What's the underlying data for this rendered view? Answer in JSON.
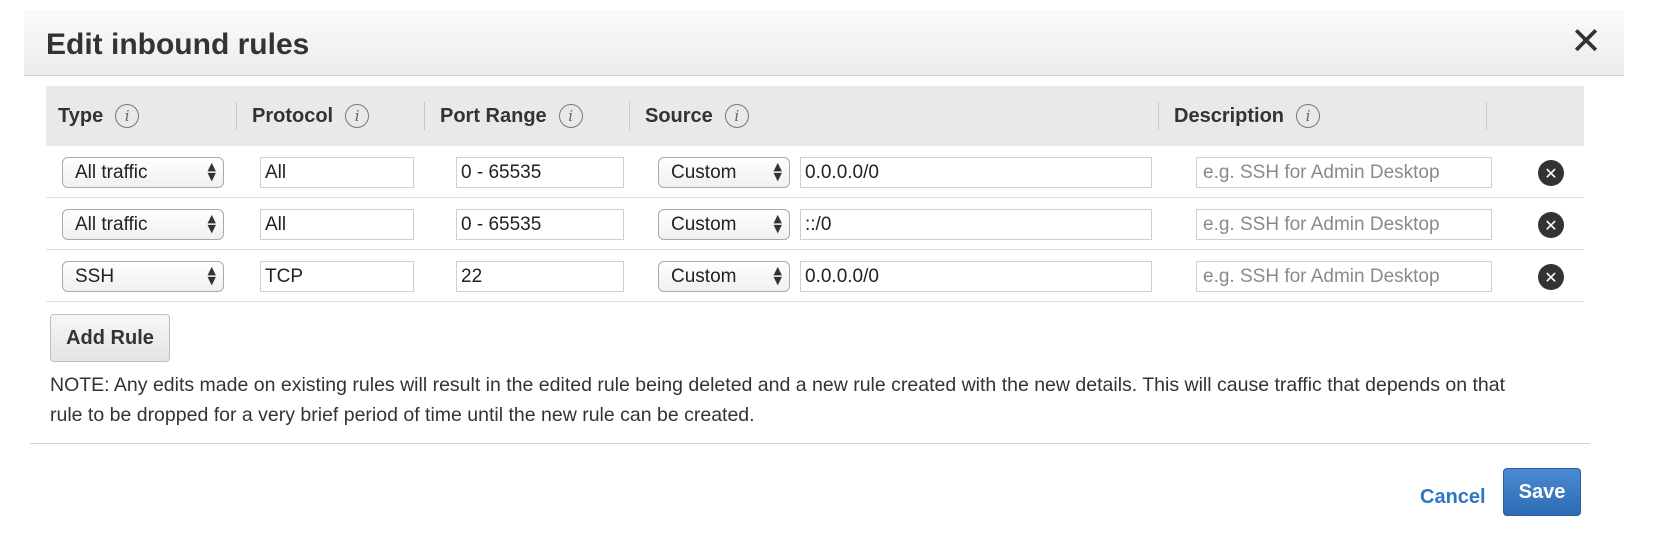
{
  "dialog": {
    "title": "Edit inbound rules",
    "close_glyph": "✕"
  },
  "table": {
    "headers": [
      "Type",
      "Protocol",
      "Port Range",
      "Source",
      "Description"
    ],
    "info_glyph": "i",
    "rows": [
      {
        "type": "All traffic",
        "protocol": "All",
        "port_range": "0 - 65535",
        "source_type": "Custom",
        "source": "0.0.0.0/0",
        "description_placeholder": "e.g. SSH for Admin Desktop"
      },
      {
        "type": "All traffic",
        "protocol": "All",
        "port_range": "0 - 65535",
        "source_type": "Custom",
        "source": "::/0",
        "description_placeholder": "e.g. SSH for Admin Desktop"
      },
      {
        "type": "SSH",
        "protocol": "TCP",
        "port_range": "22",
        "source_type": "Custom",
        "source": "0.0.0.0/0",
        "description_placeholder": "e.g. SSH for Admin Desktop"
      }
    ],
    "remove_glyph": "✕",
    "select_arrows": "▲▼"
  },
  "actions": {
    "add_rule_label": "Add Rule",
    "cancel_label": "Cancel",
    "save_label": "Save"
  },
  "note": "NOTE: Any edits made on existing rules will result in the edited rule being deleted and a new rule created with the new details. This will cause traffic that depends on that rule to be dropped for a very brief period of time until the new rule can be created.",
  "colors": {
    "accent": "#2e6bb5",
    "link": "#2d77c2",
    "header_bg": "#e9e9e9"
  }
}
